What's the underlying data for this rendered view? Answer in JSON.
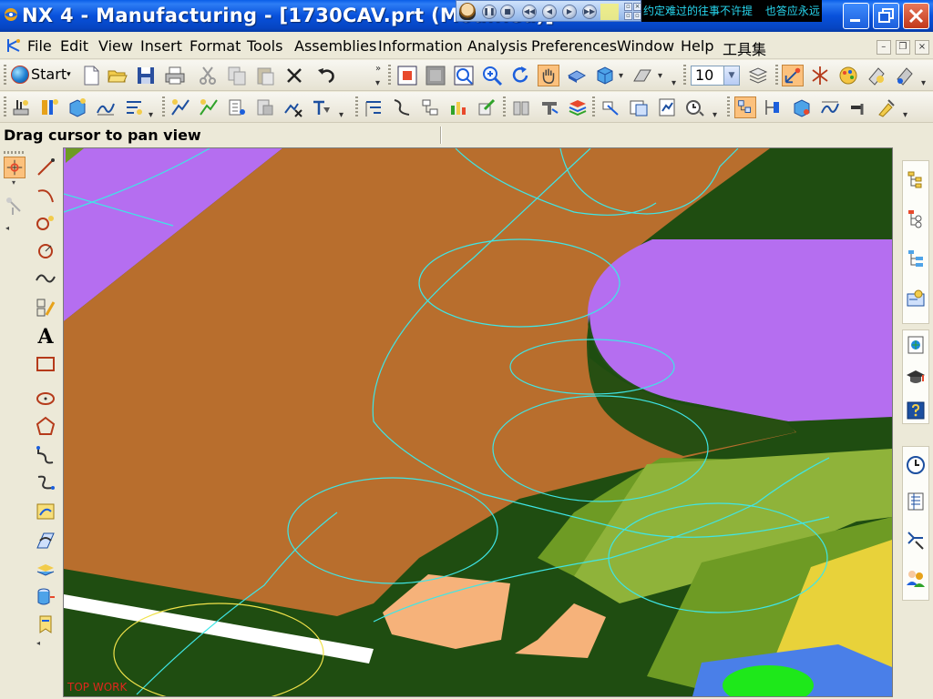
{
  "title_bar": {
    "title": "NX 4 - Manufacturing - [1730CAV.prt (Modified)]",
    "window_buttons": [
      "minimize",
      "maximize",
      "close"
    ]
  },
  "media_overlay": {
    "lyric_segments": [
      "约定难过的往事不许提",
      "也答应永远"
    ]
  },
  "menu_bar": {
    "items": [
      "File",
      "Edit",
      "View",
      "Insert",
      "Format",
      "Tools",
      "Assemblies",
      "Information",
      "Analysis",
      "Preferences",
      "Window",
      "Help",
      "工具集"
    ]
  },
  "toolbar": {
    "start_label": "Start",
    "zoom_value": "10"
  },
  "status": {
    "prompt": "Drag cursor to pan view"
  },
  "viewport": {
    "wcs_label": "TOP WORK",
    "colors": {
      "floor_brown": "#b86e2d",
      "dark_green": "#1f4d11",
      "purple": "#b56ef0",
      "mid_green": "#6e9b24",
      "light_green": "#8fb33a",
      "yellow": "#e8d23a",
      "blue": "#4a7fe8",
      "bright_green": "#1ee81a",
      "salmon": "#f6b27a",
      "toolpath_cyan": "#3fe6e6"
    }
  }
}
